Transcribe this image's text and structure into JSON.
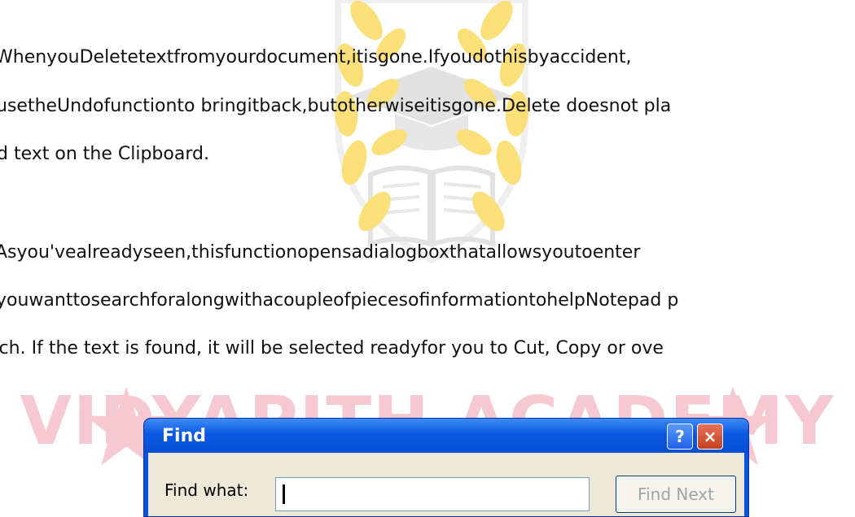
{
  "watermark": {
    "text": "VIDYAPITH ACADEMY",
    "icon": "laurel-book-cap-logo",
    "colors": {
      "gold": "#fbe07a",
      "gray": "#e5e5e5",
      "pink": "#f6c9d2"
    }
  },
  "document": {
    "lines": [
      "WhenyouDeletetextfromyourdocument,itisgone.Ifyoudothisbyaccident,",
      "usetheUndofunctionto bringitback,butotherwiseitisgone.Delete doesnot pla",
      "d text on the Clipboard.",
      "Asyou'vealreadyseen,thisfunctionopensadialogboxthatallowsyoutoenter",
      "youwanttosearchforalongwithacoupleofpiecesofinformationtohelpNotepad   p",
      "rch. If the text is found, it will be selected readyfor you to Cut, Copy or ove"
    ]
  },
  "dialog": {
    "title": "Find",
    "help_label": "?",
    "close_label": "×",
    "find_what_label": "Find what:",
    "find_what_value": "",
    "find_next_label": "Find Next",
    "colors": {
      "titlebar": "#0a58e2",
      "client": "#ece9d8",
      "close": "#c6401f"
    }
  }
}
